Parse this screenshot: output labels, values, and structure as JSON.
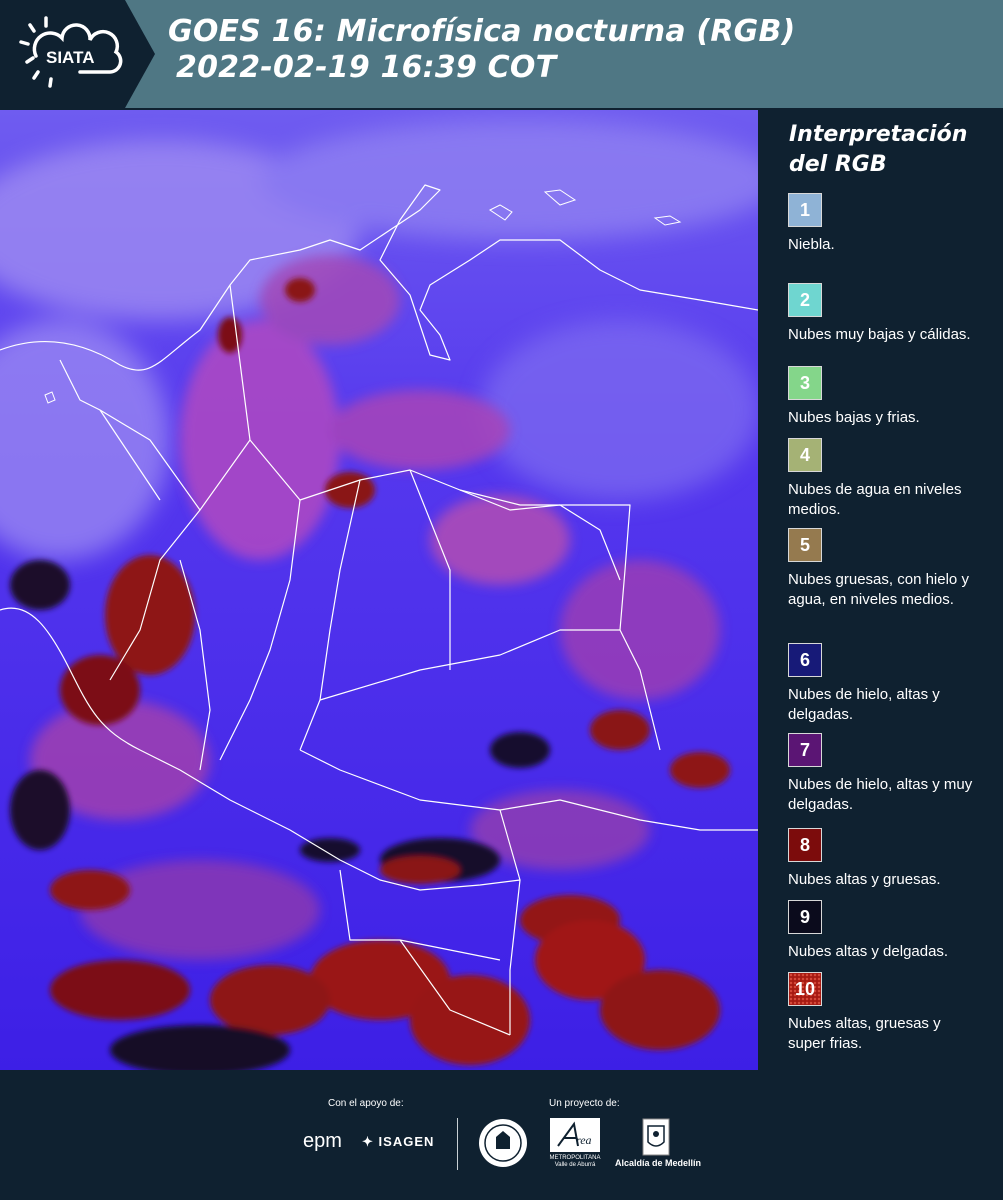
{
  "header": {
    "logo_text": "SIATA",
    "title_line1": "GOES 16: Microfísica nocturna (RGB)",
    "title_line2": "2022-02-19 16:39 COT"
  },
  "map": {
    "label": "Satellite RGB image over Colombia"
  },
  "legend": {
    "title_line1": "Interpretación",
    "title_line2": "del RGB",
    "items": [
      {
        "number": "1",
        "color": "#8fb3d6",
        "label": "Niebla."
      },
      {
        "number": "2",
        "color": "#6fd6d0",
        "label": "Nubes muy bajas y cálidas."
      },
      {
        "number": "3",
        "color": "#84d68a",
        "label": "Nubes bajas y frias."
      },
      {
        "number": "4",
        "color": "#a5b275",
        "label": "Nubes de agua en niveles medios."
      },
      {
        "number": "5",
        "color": "#957a4f",
        "label": "Nubes gruesas, con hielo y agua, en niveles medios."
      },
      {
        "number": "6",
        "color": "#171a78",
        "label": "Nubes de hielo, altas y delgadas."
      },
      {
        "number": "7",
        "color": "#5b1574",
        "label": "Nubes de hielo, altas y muy delgadas."
      },
      {
        "number": "8",
        "color": "#7c0c0c",
        "label": "Nubes altas y gruesas."
      },
      {
        "number": "9",
        "color": "#0b0b1c",
        "label": "Nubes altas y delgadas."
      },
      {
        "number": "10",
        "color": "#a61a12",
        "label": "Nubes altas, gruesas y super frias."
      }
    ]
  },
  "footer": {
    "support_label": "Con el apoyo de:",
    "project_label": "Un proyecto de:",
    "epm": "epm",
    "isagen": "ISAGEN",
    "area_text": "METROPOLITANA Valle de Aburrá",
    "alcaldia": "Alcaldía de Medellín"
  }
}
